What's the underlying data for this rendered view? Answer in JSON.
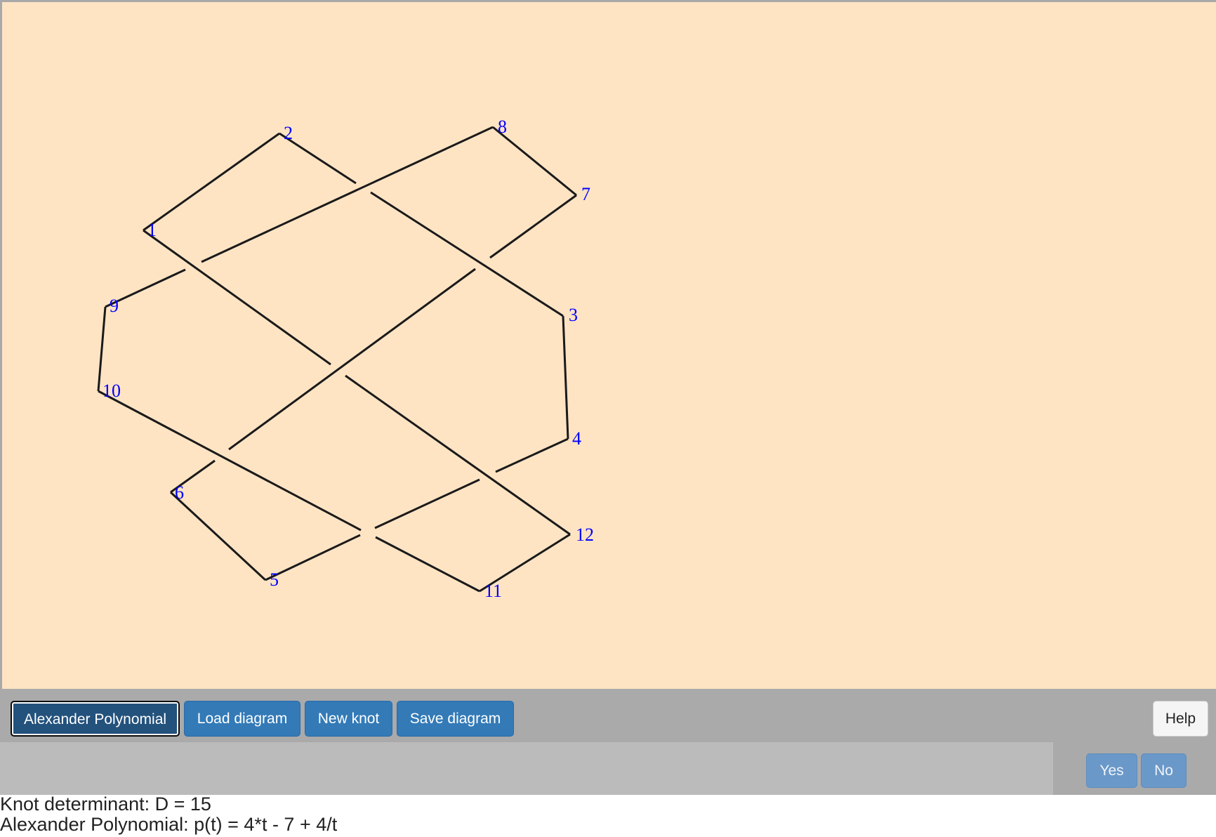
{
  "diagram": {
    "vertex_labels": [
      "1",
      "2",
      "3",
      "4",
      "5",
      "6",
      "7",
      "8",
      "9",
      "10",
      "11",
      "12"
    ]
  },
  "toolbar": {
    "alexander_label": "Alexander Polynomial",
    "load_label": "Load diagram",
    "new_knot_label": "New knot",
    "save_label": "Save diagram",
    "help_label": "Help"
  },
  "prompt": {
    "message": "",
    "yes_label": "Yes",
    "no_label": "No"
  },
  "results": {
    "determinant": "Knot determinant: D = 15",
    "polynomial": "Alexander Polynomial: p(t) = 4*t - 7 + 4/t"
  },
  "colors": {
    "canvas_bg": "#ffe4c4",
    "strand": "#1a1a1a",
    "label": "#0000ff",
    "button": "#337ab7"
  }
}
